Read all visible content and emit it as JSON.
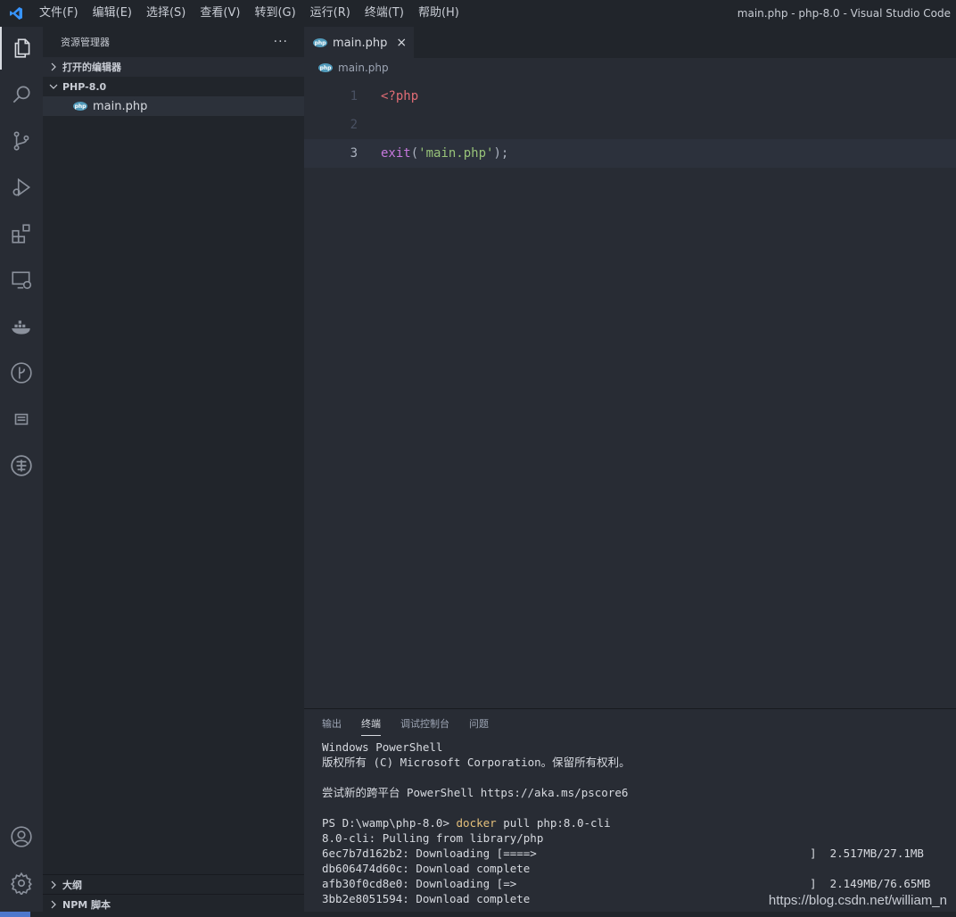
{
  "titlebar": {
    "menu": [
      "文件(F)",
      "编辑(E)",
      "选择(S)",
      "查看(V)",
      "转到(G)",
      "运行(R)",
      "终端(T)",
      "帮助(H)"
    ],
    "window_title": "main.php - php-8.0 - Visual Studio Code"
  },
  "activity_icons": [
    "explorer-icon",
    "search-icon",
    "source-control-icon",
    "run-debug-icon",
    "extensions-icon",
    "remote-explorer-icon",
    "docker-icon",
    "git-graph-icon",
    "output-list-icon",
    "remote-globe-icon",
    "account-icon",
    "settings-gear-icon"
  ],
  "sidebar": {
    "title": "资源管理器",
    "more": "···",
    "open_editors": "打开的编辑器",
    "folder": "PHP-8.0",
    "file": "main.php",
    "outline": "大纲",
    "npm": "NPM 脚本"
  },
  "editor": {
    "tab_label": "main.php",
    "tab_close": "×",
    "breadcrumb": "main.php",
    "lines": [
      {
        "num": "1",
        "tag": "<?php"
      },
      {
        "num": "2"
      },
      {
        "num": "3",
        "fn": "exit",
        "open": "(",
        "str": "'main.php'",
        "close": ");"
      }
    ]
  },
  "panel": {
    "tabs": [
      "输出",
      "终端",
      "调试控制台",
      "问题"
    ],
    "active_tab": "终端",
    "terminal": {
      "l1": "Windows PowerShell",
      "l2": "版权所有 (C) Microsoft Corporation。保留所有权利。",
      "l3": "",
      "l4": "尝试新的跨平台 PowerShell https://aka.ms/pscore6",
      "l5": "",
      "prompt": "PS D:\\wamp\\php-8.0> ",
      "cmd": "docker",
      "cmd_args": " pull php:8.0-cli",
      "l7": "8.0-cli: Pulling from library/php",
      "l8": "6ec7b7d162b2: Downloading [====>",
      "l8r": "]  2.517MB/27.1MB",
      "l9": "db606474d60c: Download complete",
      "l10": "afb30f0cd8e0: Downloading [=>",
      "l10r": "]  2.149MB/76.65MB",
      "l11": "3bb2e8051594: Download complete"
    }
  },
  "watermark": "https://blog.csdn.net/william_n",
  "colors": {
    "accent": "#4d78cc",
    "tag": "#e06c75",
    "keyword": "#c678dd",
    "string": "#98c379",
    "command": "#e5c07b"
  }
}
